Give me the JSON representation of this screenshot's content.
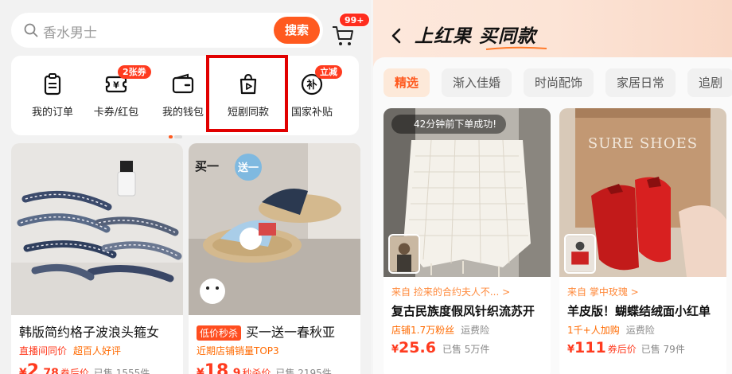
{
  "left": {
    "search": {
      "placeholder": "香水男士",
      "button": "搜索"
    },
    "cart": {
      "badge": "99+"
    },
    "quick_items": [
      {
        "label": "我的订单",
        "icon": "clipboard-icon",
        "badge": ""
      },
      {
        "label": "卡券/红包",
        "icon": "coupon-icon",
        "badge": "2张券"
      },
      {
        "label": "我的钱包",
        "icon": "wallet-icon",
        "badge": ""
      },
      {
        "label": "短剧同款",
        "icon": "drama-bag-icon",
        "badge": ""
      },
      {
        "label": "国家补贴",
        "icon": "subsidy-icon",
        "badge": "立减"
      }
    ],
    "products": [
      {
        "title": "韩版简约格子波浪头箍女",
        "note": "直播间同价",
        "note2": "超百人好评",
        "price_symbol": "¥",
        "price_int": "2",
        "price_dec": ".78",
        "price_tag": "券后价",
        "sold": "已售 1555件"
      },
      {
        "chip": "低价秒杀",
        "title": "买一送一春秋亚",
        "note": "近期店铺销量TOP3",
        "price_symbol": "¥",
        "price_int": "18",
        "price_dec": ".9",
        "price_tag": "秒杀价",
        "sold": "已售 2195件",
        "overlay_a": "买一",
        "overlay_b": "送一"
      }
    ]
  },
  "right": {
    "title": "上红果 买同款",
    "tabs": [
      "精选",
      "渐入佳婚",
      "时尚配饰",
      "家居日常",
      "追剧"
    ],
    "cards": [
      {
        "toast": "42分钟前下单成功!",
        "source": "来自 捡来的合约夫人不... >",
        "title": "复古民族度假风针织流苏开",
        "meta": "店铺1.7万粉丝",
        "meta2": "运费险",
        "price_symbol": "¥",
        "price": "25.6",
        "price_tag": "",
        "sold": "已售 5万件"
      },
      {
        "overlay": "SURE SHOES",
        "source": "来自 掌中玫瑰 >",
        "title": "羊皮版！蝴蝶结绒面小红单",
        "meta": "1千+人加购",
        "meta2": "运费险",
        "price_symbol": "¥",
        "price": "111",
        "price_tag": "券后价",
        "sold": "已售 79件"
      }
    ]
  }
}
